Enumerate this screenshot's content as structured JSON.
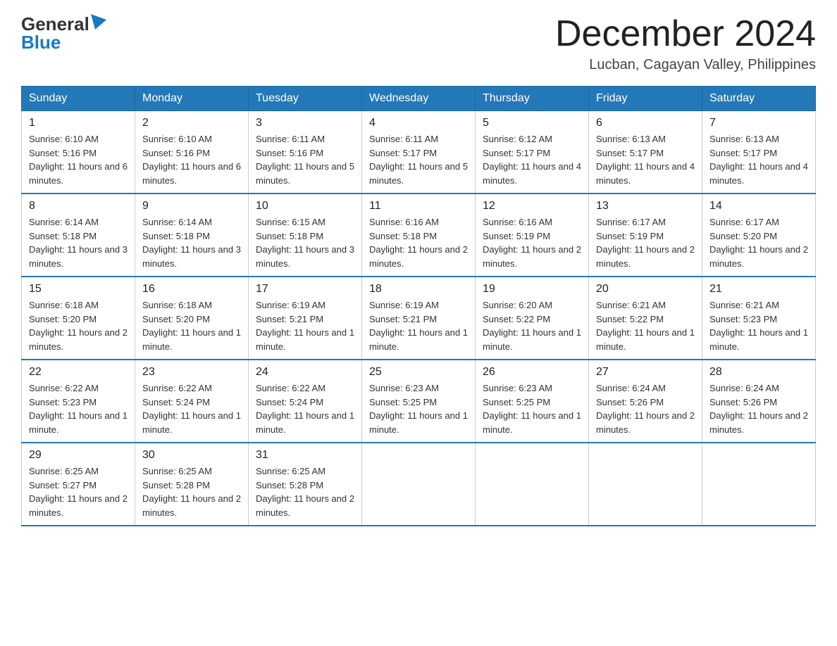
{
  "header": {
    "logo_general": "General",
    "logo_blue": "Blue",
    "month_title": "December 2024",
    "location": "Lucban, Cagayan Valley, Philippines"
  },
  "weekdays": [
    "Sunday",
    "Monday",
    "Tuesday",
    "Wednesday",
    "Thursday",
    "Friday",
    "Saturday"
  ],
  "weeks": [
    [
      {
        "day": "1",
        "sunrise": "6:10 AM",
        "sunset": "5:16 PM",
        "daylight": "11 hours and 6 minutes."
      },
      {
        "day": "2",
        "sunrise": "6:10 AM",
        "sunset": "5:16 PM",
        "daylight": "11 hours and 6 minutes."
      },
      {
        "day": "3",
        "sunrise": "6:11 AM",
        "sunset": "5:16 PM",
        "daylight": "11 hours and 5 minutes."
      },
      {
        "day": "4",
        "sunrise": "6:11 AM",
        "sunset": "5:17 PM",
        "daylight": "11 hours and 5 minutes."
      },
      {
        "day": "5",
        "sunrise": "6:12 AM",
        "sunset": "5:17 PM",
        "daylight": "11 hours and 4 minutes."
      },
      {
        "day": "6",
        "sunrise": "6:13 AM",
        "sunset": "5:17 PM",
        "daylight": "11 hours and 4 minutes."
      },
      {
        "day": "7",
        "sunrise": "6:13 AM",
        "sunset": "5:17 PM",
        "daylight": "11 hours and 4 minutes."
      }
    ],
    [
      {
        "day": "8",
        "sunrise": "6:14 AM",
        "sunset": "5:18 PM",
        "daylight": "11 hours and 3 minutes."
      },
      {
        "day": "9",
        "sunrise": "6:14 AM",
        "sunset": "5:18 PM",
        "daylight": "11 hours and 3 minutes."
      },
      {
        "day": "10",
        "sunrise": "6:15 AM",
        "sunset": "5:18 PM",
        "daylight": "11 hours and 3 minutes."
      },
      {
        "day": "11",
        "sunrise": "6:16 AM",
        "sunset": "5:18 PM",
        "daylight": "11 hours and 2 minutes."
      },
      {
        "day": "12",
        "sunrise": "6:16 AM",
        "sunset": "5:19 PM",
        "daylight": "11 hours and 2 minutes."
      },
      {
        "day": "13",
        "sunrise": "6:17 AM",
        "sunset": "5:19 PM",
        "daylight": "11 hours and 2 minutes."
      },
      {
        "day": "14",
        "sunrise": "6:17 AM",
        "sunset": "5:20 PM",
        "daylight": "11 hours and 2 minutes."
      }
    ],
    [
      {
        "day": "15",
        "sunrise": "6:18 AM",
        "sunset": "5:20 PM",
        "daylight": "11 hours and 2 minutes."
      },
      {
        "day": "16",
        "sunrise": "6:18 AM",
        "sunset": "5:20 PM",
        "daylight": "11 hours and 1 minute."
      },
      {
        "day": "17",
        "sunrise": "6:19 AM",
        "sunset": "5:21 PM",
        "daylight": "11 hours and 1 minute."
      },
      {
        "day": "18",
        "sunrise": "6:19 AM",
        "sunset": "5:21 PM",
        "daylight": "11 hours and 1 minute."
      },
      {
        "day": "19",
        "sunrise": "6:20 AM",
        "sunset": "5:22 PM",
        "daylight": "11 hours and 1 minute."
      },
      {
        "day": "20",
        "sunrise": "6:21 AM",
        "sunset": "5:22 PM",
        "daylight": "11 hours and 1 minute."
      },
      {
        "day": "21",
        "sunrise": "6:21 AM",
        "sunset": "5:23 PM",
        "daylight": "11 hours and 1 minute."
      }
    ],
    [
      {
        "day": "22",
        "sunrise": "6:22 AM",
        "sunset": "5:23 PM",
        "daylight": "11 hours and 1 minute."
      },
      {
        "day": "23",
        "sunrise": "6:22 AM",
        "sunset": "5:24 PM",
        "daylight": "11 hours and 1 minute."
      },
      {
        "day": "24",
        "sunrise": "6:22 AM",
        "sunset": "5:24 PM",
        "daylight": "11 hours and 1 minute."
      },
      {
        "day": "25",
        "sunrise": "6:23 AM",
        "sunset": "5:25 PM",
        "daylight": "11 hours and 1 minute."
      },
      {
        "day": "26",
        "sunrise": "6:23 AM",
        "sunset": "5:25 PM",
        "daylight": "11 hours and 1 minute."
      },
      {
        "day": "27",
        "sunrise": "6:24 AM",
        "sunset": "5:26 PM",
        "daylight": "11 hours and 2 minutes."
      },
      {
        "day": "28",
        "sunrise": "6:24 AM",
        "sunset": "5:26 PM",
        "daylight": "11 hours and 2 minutes."
      }
    ],
    [
      {
        "day": "29",
        "sunrise": "6:25 AM",
        "sunset": "5:27 PM",
        "daylight": "11 hours and 2 minutes."
      },
      {
        "day": "30",
        "sunrise": "6:25 AM",
        "sunset": "5:28 PM",
        "daylight": "11 hours and 2 minutes."
      },
      {
        "day": "31",
        "sunrise": "6:25 AM",
        "sunset": "5:28 PM",
        "daylight": "11 hours and 2 minutes."
      },
      null,
      null,
      null,
      null
    ]
  ]
}
